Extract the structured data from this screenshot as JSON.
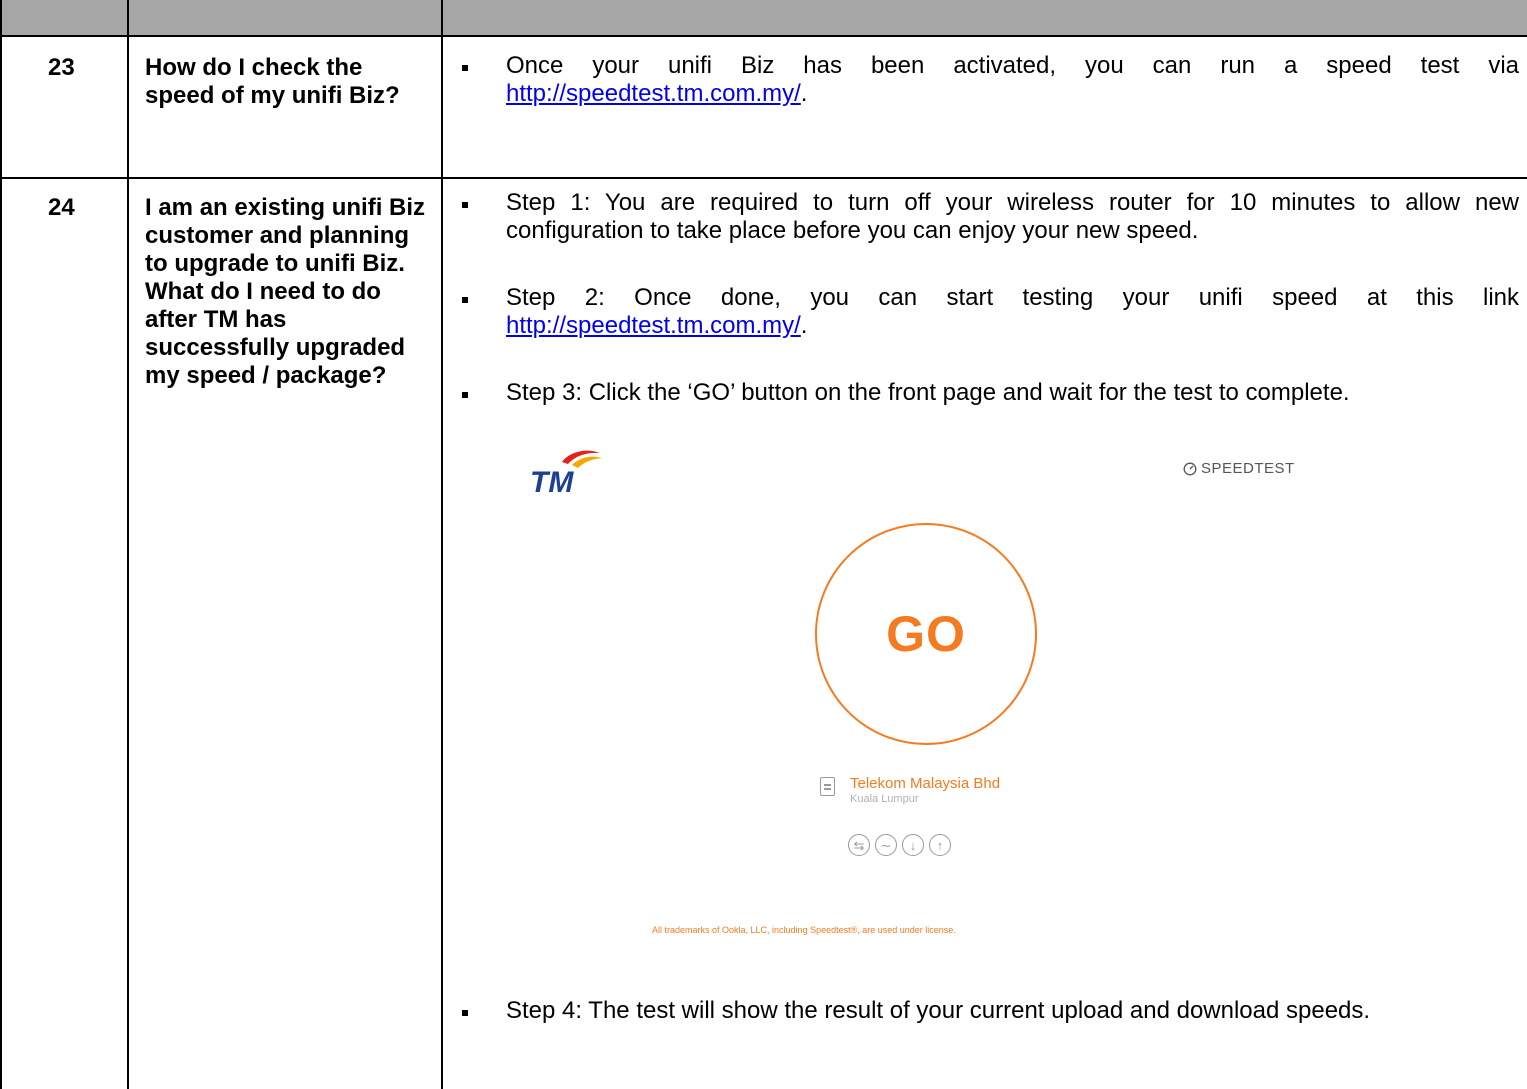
{
  "rows": [
    {
      "number": "23",
      "question": "How do I check the speed of my unifi Biz?",
      "answers": [
        {
          "text": "Once your unifi Biz has been activated, you can run a speed test via ",
          "link": "http://speedtest.tm.com.my/",
          "after": "."
        }
      ]
    },
    {
      "number": "24",
      "question": "I am an existing unifi Biz customer and planning to upgrade to unifi Biz. What do I need to do after TM has successfully upgraded my speed / package?",
      "answers": [
        {
          "text": "Step 1: You are required to turn off your wireless router for 10 minutes to allow new configuration to take place before you can enjoy your new speed."
        },
        {
          "text": "Step 2: Once done, you can start testing your unifi speed at this link ",
          "link": "http://speedtest.tm.com.my/",
          "after": "."
        },
        {
          "text": "Step 3: Click the ‘GO’ button on the front page and wait for the test to complete."
        },
        {
          "text": "Step 4: The test will show the result of your current upload and download speeds."
        }
      ]
    }
  ],
  "speedtest": {
    "logo_text": "TM",
    "brand": "SPEEDTEST",
    "go_label": "GO",
    "isp_name": "Telekom Malaysia Bhd",
    "isp_location": "Kuala Lumpur",
    "trademark": "All trademarks of Ookla, LLC, including Speedtest®, are used under license.",
    "accent_color": "#f47b20",
    "mode_icons": [
      "multi-connection-icon",
      "ping-icon",
      "download-icon",
      "upload-icon"
    ]
  },
  "colors": {
    "header_band": "#a6a6a6",
    "link": "#0000ee"
  }
}
